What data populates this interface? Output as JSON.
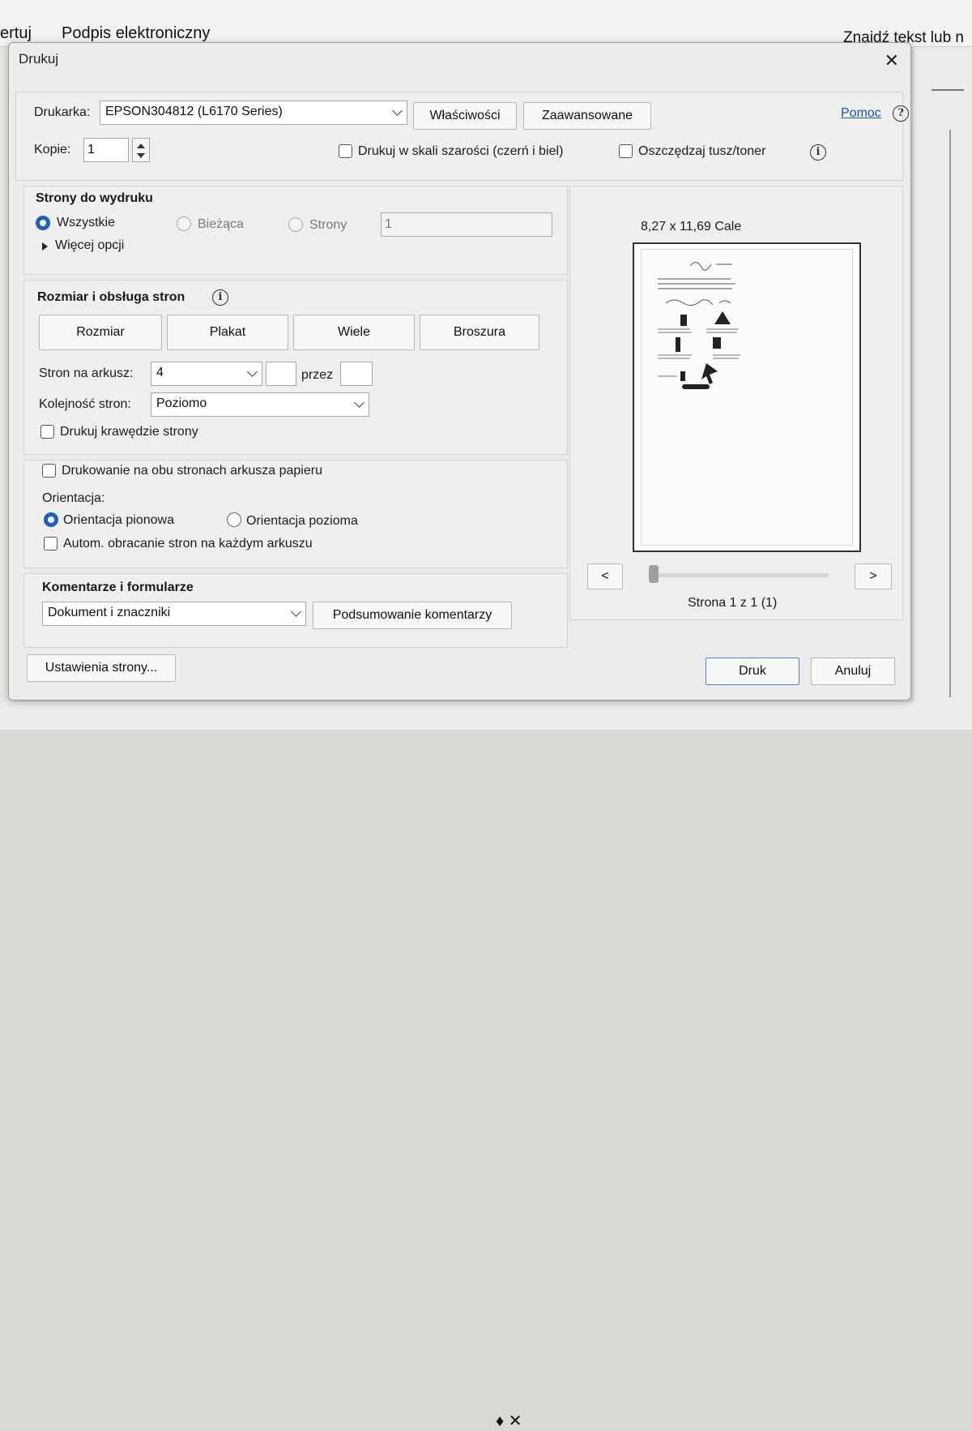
{
  "background": {
    "menu_left": "ertuj",
    "menu_signature": "Podpis elektroniczny",
    "search_text": "Znajdź tekst lub n",
    "bottom_icons": "♦ ✕"
  },
  "dialog": {
    "title": "Drukuj",
    "close_icon": "✕"
  },
  "printer": {
    "label": "Drukarka:",
    "selected": "EPSON304812 (L6170 Series)",
    "properties_button": "Właściwości",
    "advanced_button": "Zaawansowane",
    "help_link": "Pomoc",
    "help_icon": "?",
    "copies_label": "Kopie:",
    "copies_value": "1",
    "grayscale_label": "Drukuj w skali szarości (czerń i biel)",
    "grayscale_checked": false,
    "save_ink_label": "Oszczędzaj tusz/toner",
    "save_ink_checked": false,
    "info_icon": "i"
  },
  "pages": {
    "title": "Strony do wydruku",
    "all_label": "Wszystkie",
    "current_label": "Bieżąca",
    "pages_label": "Strony",
    "pages_value": "1",
    "more_options": "Więcej opcji"
  },
  "sizing": {
    "title": "Rozmiar i obsługa stron",
    "info_icon": "i",
    "btn_size": "Rozmiar",
    "btn_poster": "Plakat",
    "btn_multiple": "Wiele",
    "btn_booklet": "Broszura",
    "pages_per_sheet_label": "Stron na arkusz:",
    "pages_per_sheet_value": "4",
    "by_label": "przez",
    "order_label": "Kolejność stron:",
    "order_value": "Poziomo",
    "print_borders_label": "Drukuj krawędzie strony"
  },
  "duplex": {
    "both_sides_label": "Drukowanie na obu stronach arkusza papieru",
    "orientation_label": "Orientacja:",
    "portrait_label": "Orientacja pionowa",
    "landscape_label": "Orientacja pozioma",
    "auto_rotate_label": "Autom. obracanie stron na każdym arkuszu"
  },
  "comments": {
    "title": "Komentarze i formularze",
    "selected": "Dokument i znaczniki",
    "summary_button": "Podsumowanie komentarzy"
  },
  "preview": {
    "size_text": "8,27 x 11,69 Cale",
    "prev_button": "<",
    "next_button": ">",
    "page_text": "Strona 1 z 1 (1)"
  },
  "footer": {
    "page_setup_button": "Ustawienia strony...",
    "print_button": "Druk",
    "cancel_button": "Anuluj"
  },
  "colors": {
    "accent": "#1f5fbf",
    "link": "#1d4fb0",
    "dialog_bg": "#ececea"
  }
}
